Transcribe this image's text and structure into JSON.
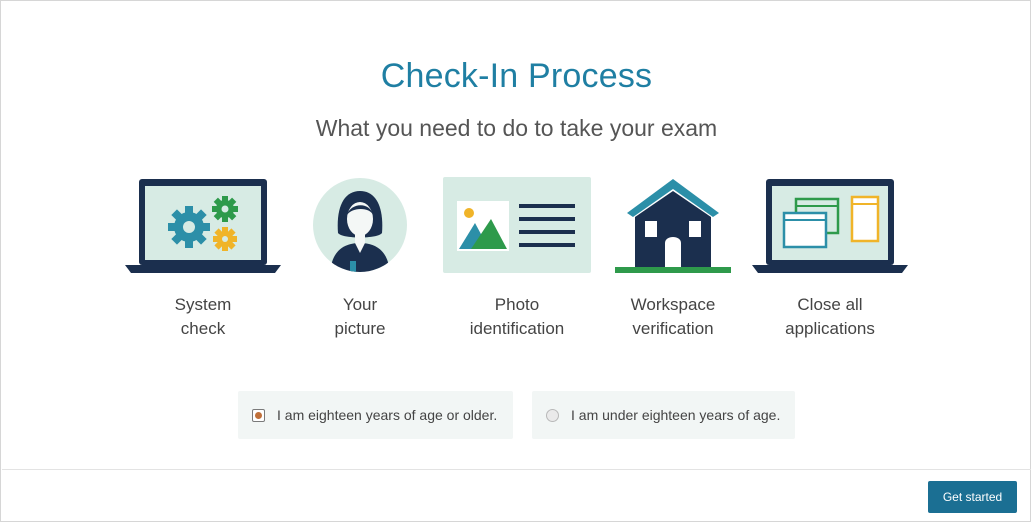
{
  "header": {
    "title": "Check-In Process",
    "subtitle": "What you need to do to take your exam"
  },
  "steps": [
    {
      "icon": "laptop-gears-icon",
      "line1": "System",
      "line2": "check"
    },
    {
      "icon": "person-avatar-icon",
      "line1": "Your",
      "line2": "picture"
    },
    {
      "icon": "id-card-icon",
      "line1": "Photo",
      "line2": "identification"
    },
    {
      "icon": "house-icon",
      "line1": "Workspace",
      "line2": "verification"
    },
    {
      "icon": "laptop-windows-icon",
      "line1": "Close all",
      "line2": "applications"
    }
  ],
  "age": {
    "options": [
      {
        "label": "I am eighteen years of age or older.",
        "selected": true
      },
      {
        "label": "I am under eighteen years of age.",
        "selected": false
      }
    ]
  },
  "footer": {
    "button_label": "Get started"
  },
  "colors": {
    "accent": "#1f7fa3",
    "navy": "#1b2f4e",
    "button": "#1b6f93",
    "teal": "#2c8fa8",
    "green": "#2e9a4b",
    "mint": "#d7ebe4"
  }
}
